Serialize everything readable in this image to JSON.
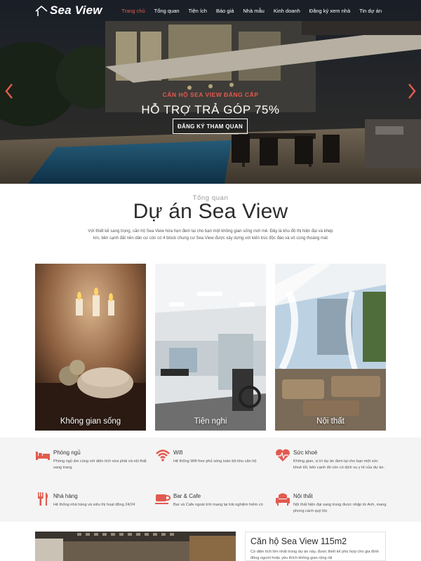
{
  "brand": {
    "logo_text": "Sea View"
  },
  "nav": {
    "items": [
      {
        "label": "Trang chủ",
        "active": true
      },
      {
        "label": "Tổng quan"
      },
      {
        "label": "Tiện ích"
      },
      {
        "label": "Báo giá"
      },
      {
        "label": "Nhà mẫu"
      },
      {
        "label": "Kinh doanh"
      },
      {
        "label": "Đăng ký xem nhà"
      },
      {
        "label": "Tin dự án"
      }
    ]
  },
  "hero": {
    "subtitle": "CĂN HỘ SEA VIEW ĐẲNG CẤP",
    "title": "HỖ TRỢ TRẢ GÓP 75%",
    "cta_label": "ĐĂNG KÝ THAM QUAN",
    "prev_icon": "chevron-left-icon",
    "next_icon": "chevron-right-icon"
  },
  "overview": {
    "eyebrow": "Tổng quan",
    "title": "Dự án Sea View",
    "description": "Với thiết kế sang trọng, căn hộ Sea View hứa hẹn đem lại cho bạn một không gian sống mới mẻ. Đây là khu đô thị hiện đại và khép kín, bên cạnh đất nền dân cư còn có 4 block chung cư Sea View được xây dựng với kiến trúc độc đáo và vô cùng thoáng mát"
  },
  "cards": [
    {
      "label": "Không gian sống"
    },
    {
      "label": "Tiện nghi"
    },
    {
      "label": "Nội thất"
    }
  ],
  "features": [
    {
      "icon": "bed-icon",
      "title": "Phòng ngủ",
      "desc": "Phòng ngủ ấm cúng với diện tích vừa phải và nội thất sang trang"
    },
    {
      "icon": "wifi-icon",
      "title": "Wifi",
      "desc": "Hệ thống Wifi free phủ sóng toàn bộ khu căn hộ"
    },
    {
      "icon": "heartbeat-icon",
      "title": "Sức khoẻ",
      "desc": "Không gian, vị trí dự án đem lại cho bạn một sức khoẻ tốt, bên cạnh đó còn có dịch vụ y tế của dự án."
    },
    {
      "icon": "cutlery-icon",
      "title": "Nhà hàng",
      "desc": "Hệ thống nhà hàng và siêu thị hoạt động 24/24"
    },
    {
      "icon": "coffee-icon",
      "title": "Bar & Cafe",
      "desc": "Bar và Cafe ngoài trời mang lại trải nghiệm hiếm có"
    },
    {
      "icon": "armchair-icon",
      "title": "Nội thất",
      "desc": "Nội thất hiện đại sang trong được nhập từ Anh, mang phong cách quý tộc"
    }
  ],
  "apartment": {
    "title": "Căn hộ Sea View 115m2",
    "desc": "Có diện tích lớn nhất trong dự án này, được thiết kế phù hợp cho gia đình đông người hoặc yêu thích không gian rộng rãi"
  },
  "colors": {
    "accent": "#e25a4f",
    "features_bg": "#f4f4f4"
  }
}
